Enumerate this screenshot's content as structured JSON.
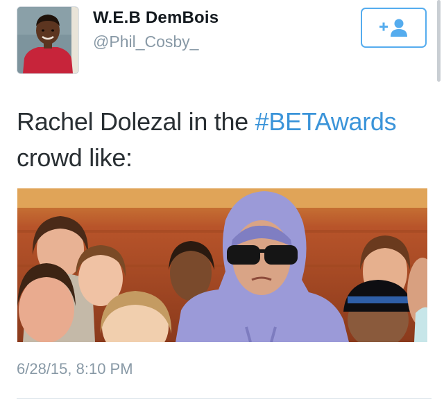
{
  "user": {
    "display_name": "W.E.B DemBois",
    "handle": "@Phil_Cosby_"
  },
  "follow_button": {
    "icon": "add-user-icon",
    "color": "#55acee"
  },
  "tweet": {
    "text_before": "Rachel Dolezal in the ",
    "hashtag": "#BETAwards",
    "text_after": " crowd like:",
    "timestamp": "6/28/15, 8:10 PM"
  },
  "colors": {
    "name": "#141a1f",
    "handle": "#8899a6",
    "text": "#292f33",
    "hashtag": "#3b94d9",
    "accent": "#55acee"
  }
}
